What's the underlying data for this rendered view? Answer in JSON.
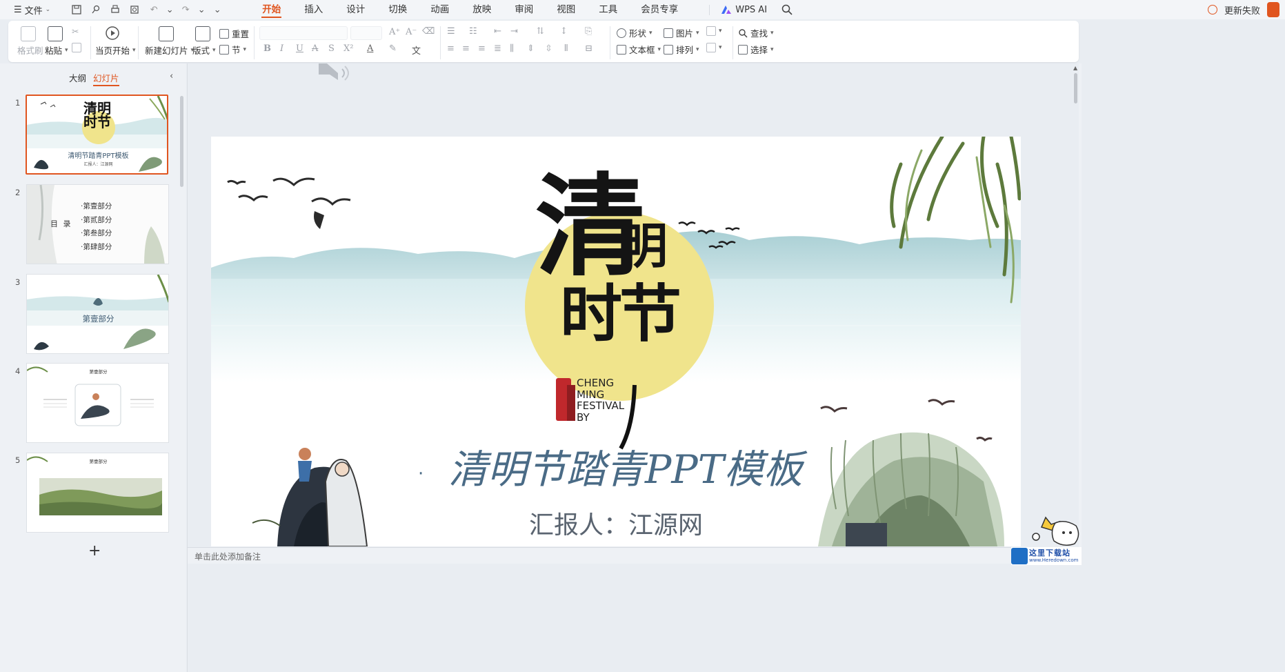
{
  "menubar": {
    "file_label": "文件",
    "tabs": [
      "开始",
      "插入",
      "设计",
      "切换",
      "动画",
      "放映",
      "审阅",
      "视图",
      "工具",
      "会员专享"
    ],
    "active_tab": "开始",
    "wps_ai_label": "WPS AI",
    "update_label": "更新失败"
  },
  "ribbon": {
    "format_painter": "格式刷",
    "paste": "粘贴",
    "play_from_current": "当页开始",
    "new_slide": "新建幻灯片",
    "layout": "版式",
    "reset": "重置",
    "section": "节",
    "shape": "形状",
    "picture": "图片",
    "textbox": "文本框",
    "arrange": "排列",
    "find": "查找",
    "select": "选择"
  },
  "left_panel": {
    "tab_outline": "大纲",
    "tab_slides": "幻灯片",
    "active_tab": "幻灯片",
    "slides": [
      {
        "num": "1",
        "title_big": "清明",
        "title_small": "时节",
        "subtitle": "清明节踏青PPT模板",
        "caption": "汇报人：江源网"
      },
      {
        "num": "2",
        "toc_label": "目  录",
        "items": [
          "·第壹部分",
          "·第贰部分",
          "·第叁部分",
          "·第肆部分"
        ]
      },
      {
        "num": "3",
        "section": "第壹部分"
      },
      {
        "num": "4",
        "header": "第壹部分"
      },
      {
        "num": "5",
        "header": "第壹部分"
      }
    ],
    "add_label": "+"
  },
  "slide": {
    "title_qing": "清",
    "title_ming": "明",
    "title_shijie": "时节",
    "festival_en": [
      "CHENG",
      "MING",
      "FESTIVAL",
      "BY"
    ],
    "bullet": "·",
    "main_title": "清明节踏青PPT模板",
    "reporter": "汇报人：江源网"
  },
  "notes_placeholder": "单击此处添加备注",
  "watermark": {
    "cn": "这里下载站",
    "url": "www.Heredown.com"
  },
  "colors": {
    "accent": "#e0551f",
    "sun": "#f0e48c",
    "ink": "#1a1a1a",
    "title_blue": "#4a6b86"
  }
}
